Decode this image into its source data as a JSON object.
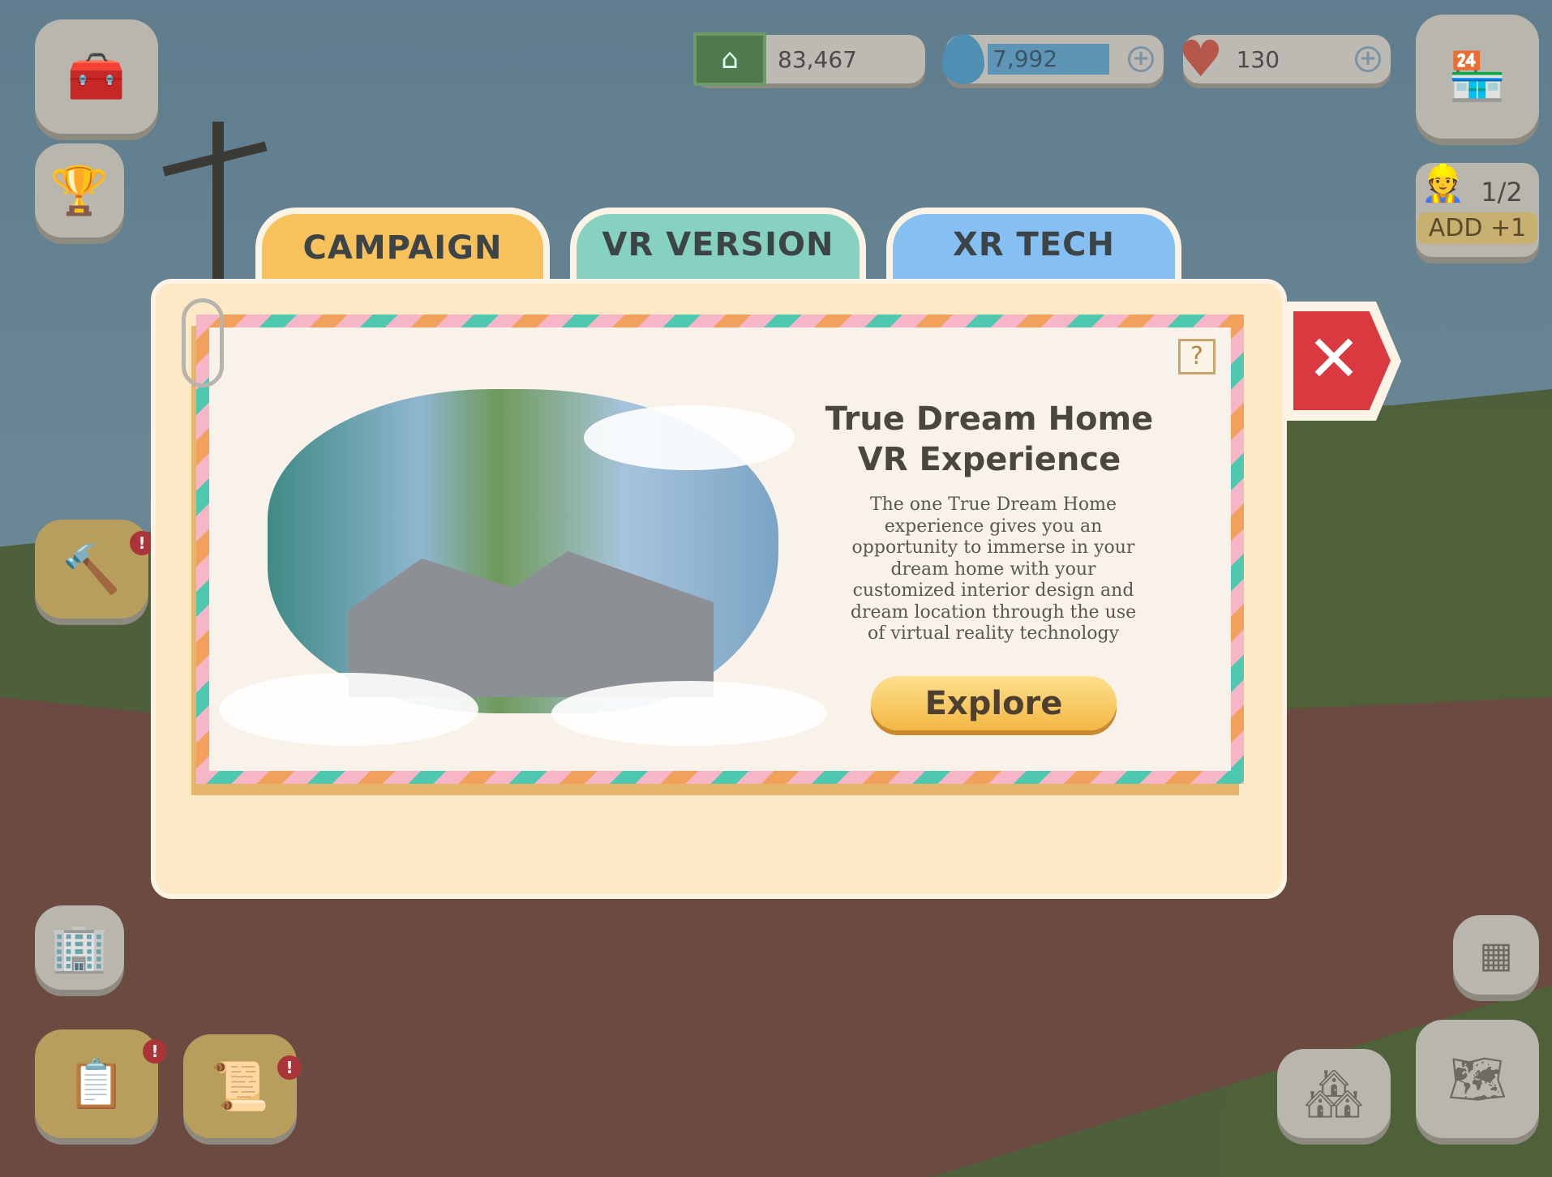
{
  "resources": {
    "cash": {
      "icon": "cash-house-icon",
      "value": "83,467"
    },
    "water": {
      "icon": "water-drop-icon",
      "value": "7,992",
      "add": "+"
    },
    "hearts": {
      "icon": "heart-icon",
      "value": "130",
      "add": "+"
    }
  },
  "workers": {
    "count": "1/2",
    "add_label": "ADD +1"
  },
  "modal": {
    "tabs": [
      {
        "label": "CAMPAIGN",
        "color": "#f7c25b",
        "active": true
      },
      {
        "label": "VR VERSION",
        "color": "#86d1c0",
        "active": false
      },
      {
        "label": "XR TECH",
        "color": "#86bff2",
        "active": false
      }
    ],
    "help": "?",
    "close": "✕",
    "title": "True Dream Home VR Experience",
    "description": "The one True Dream Home experience gives you an opportunity to immerse in your dream home with your customized interior design and dream location through the use of virtual reality technology",
    "button": "Explore"
  },
  "badges": {
    "alert": "!"
  }
}
